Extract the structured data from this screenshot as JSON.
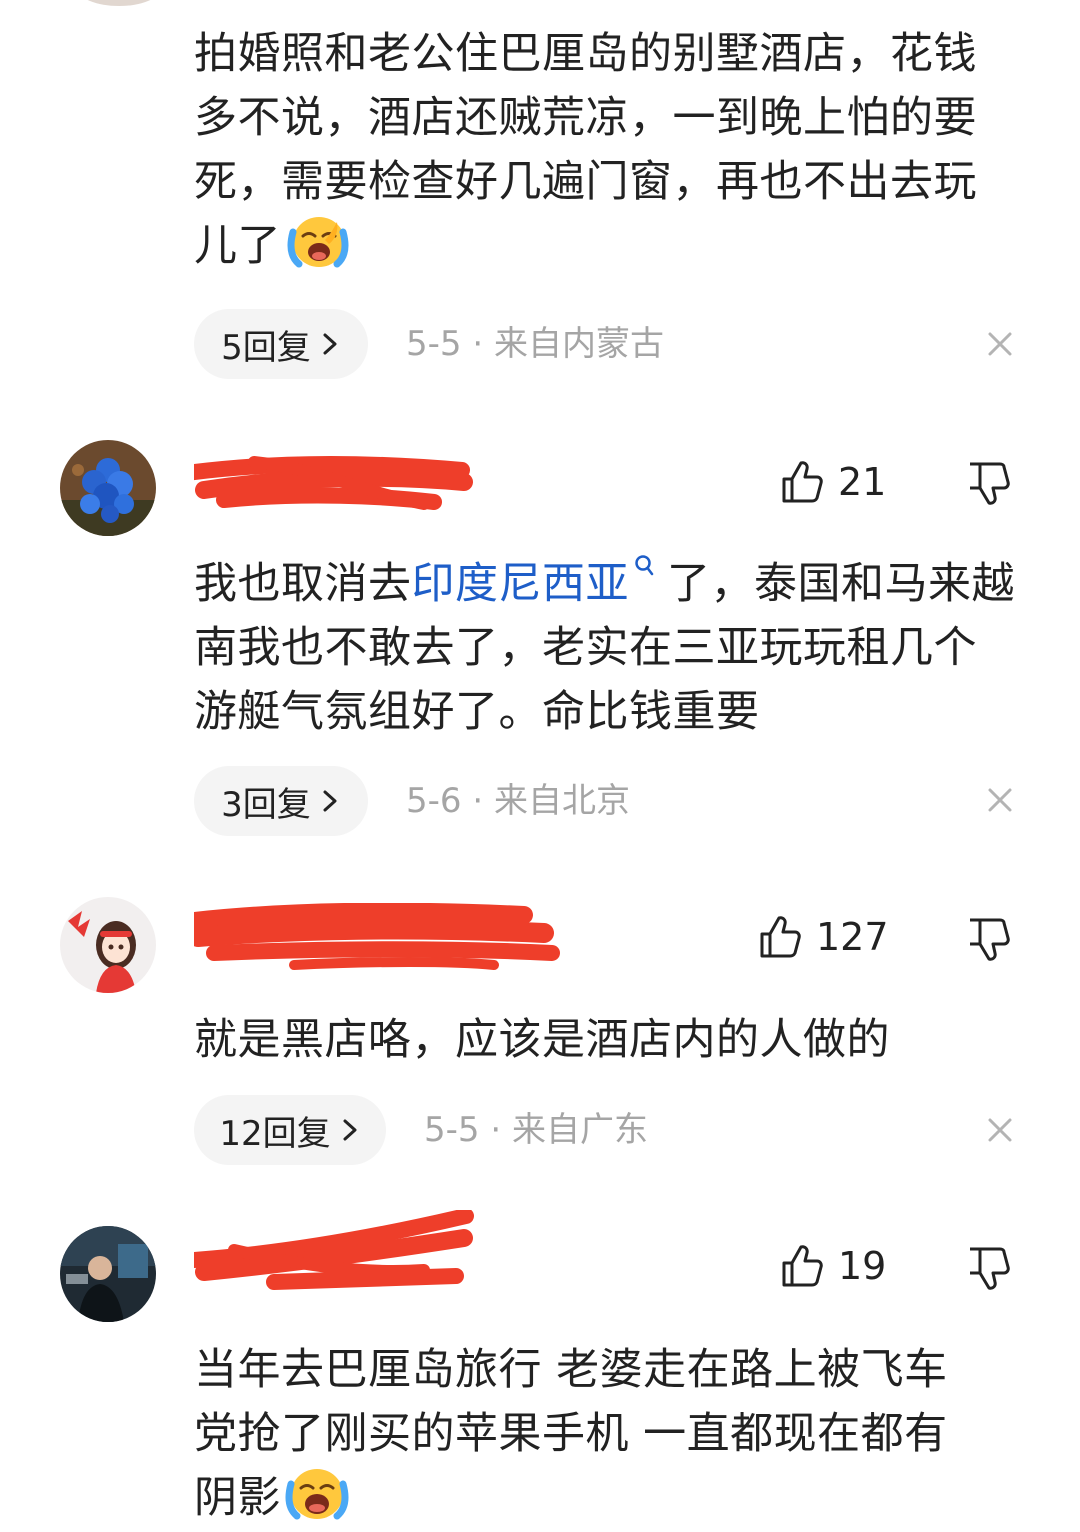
{
  "comments": [
    {
      "text": "拍婚照和老公住巴厘岛的别墅酒店，花钱多不说，酒店还贼荒凉，一到晚上怕的要死，需要检查好几遍门窗，再也不出去玩儿了",
      "emoji": "crying-face-emoji",
      "reply_label": "5回复",
      "date": "5-5",
      "location": "来自内蒙古"
    },
    {
      "username": "",
      "likes": "21",
      "text_before": "我也取消去",
      "link": "印度尼西亚",
      "text_after": "了，泰国和马来越南我也不敢去了，老实在三亚玩玩租几个游艇气氛组好了。命比钱重要",
      "reply_label": "3回复",
      "date": "5-6",
      "location": "来自北京"
    },
    {
      "username": "",
      "likes": "127",
      "text": "就是黑店咯，应该是酒店内的人做的",
      "reply_label": "12回复",
      "date": "5-5",
      "location": "来自广东"
    },
    {
      "username": "",
      "likes": "19",
      "text": "当年去巴厘岛旅行 老婆走在路上被飞车党抢了刚买的苹果手机 一直都现在都有阴影",
      "emoji": "crying-face-emoji"
    }
  ],
  "meta_separator": " · ",
  "colors": {
    "text": "#222222",
    "muted": "#a5a5a5",
    "link": "#1e5ec8",
    "pill_bg": "#f4f4f4",
    "redaction": "#ee3e2a",
    "emoji_yellow": "#ffc83d",
    "tears_blue": "#4aa8f5"
  },
  "icons": {
    "like": "thumbs-up-outline-icon",
    "dislike": "thumbs-down-outline-icon",
    "close": "close-x-icon",
    "chevron": "chevron-right-icon",
    "search": "search-magnifier-icon"
  }
}
